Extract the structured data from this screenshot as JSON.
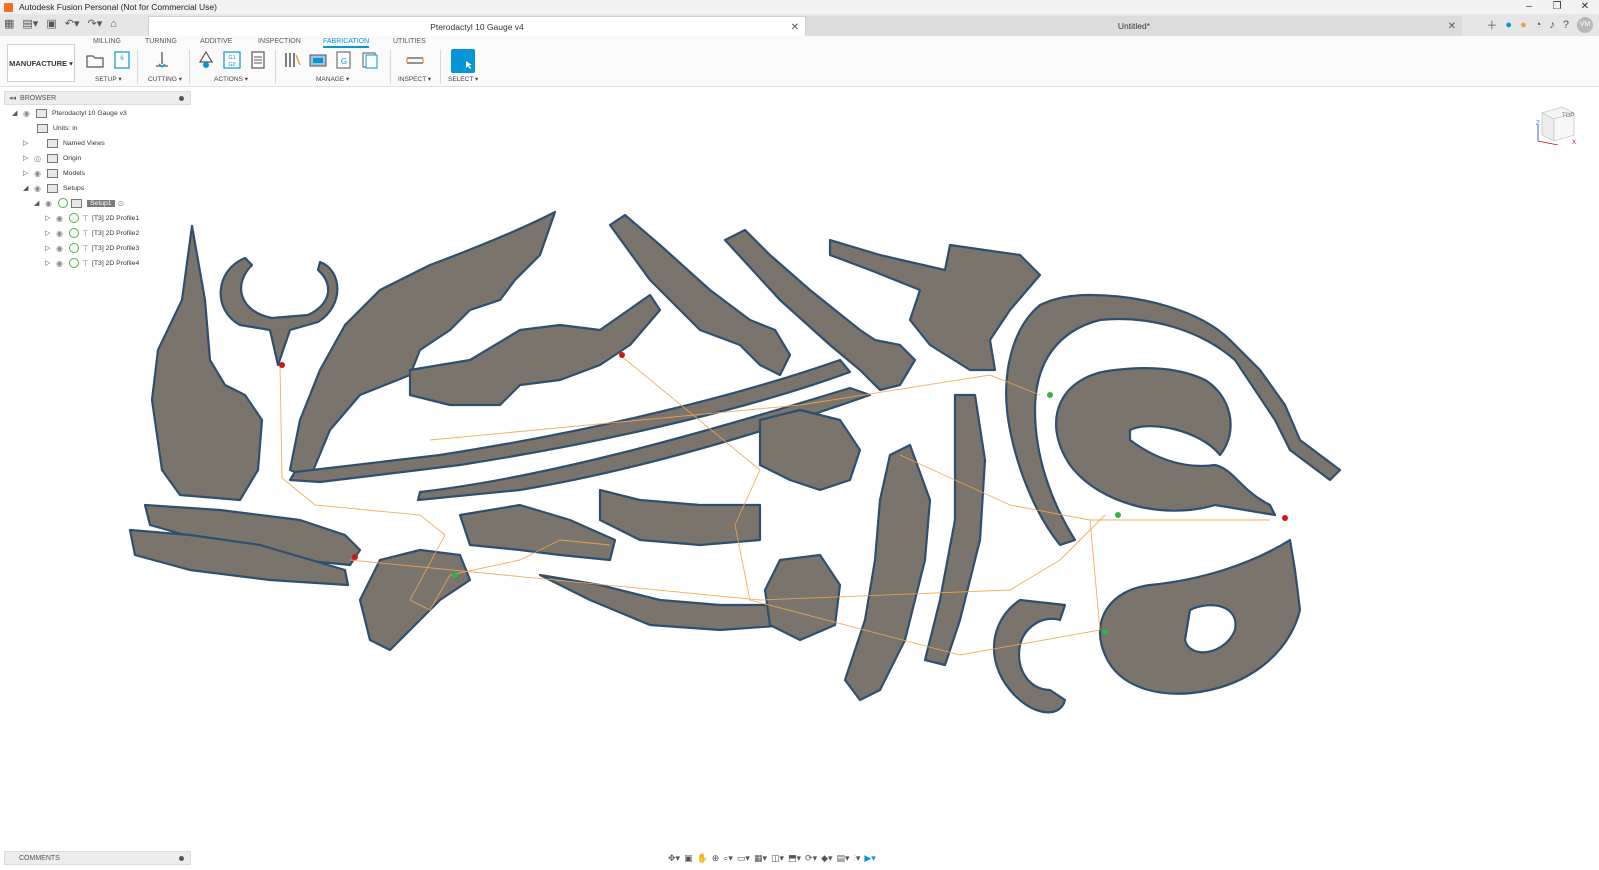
{
  "window": {
    "title": "Autodesk Fusion Personal (Not for Commercial Use)",
    "controls": [
      "–",
      "❐",
      "✕"
    ]
  },
  "document_tabs": [
    {
      "title": "Pterodactyl 10 Gauge v4",
      "active": true
    },
    {
      "title": "Untitled*",
      "active": false
    }
  ],
  "toolbar": {
    "workspace": "MANUFACTURE",
    "tabs": [
      "MILLING",
      "TURNING",
      "ADDITIVE",
      "INSPECTION",
      "FABRICATION",
      "UTILITIES"
    ],
    "active_tab": "FABRICATION",
    "groups": [
      "SETUP",
      "CUTTING",
      "ACTIONS",
      "MANAGE",
      "INSPECT",
      "SELECT"
    ],
    "actions_icon_text": [
      "G1",
      "G2"
    ],
    "accent": "#0696d7"
  },
  "browser": {
    "title": "BROWSER",
    "root": "Pterodactyl 10 Gauge v3",
    "units": "Units: in",
    "nodes": [
      "Named Views",
      "Origin",
      "Models",
      "Setups"
    ],
    "setup": "Setup1",
    "profiles": [
      "[T3] 2D Profile1",
      "[T3] 2D Profile2",
      "[T3] 2D Profile3",
      "[T3] 2D Profile4"
    ]
  },
  "viewcube": {
    "face": "TOP",
    "axis_x": "X",
    "axis_z": "Z"
  },
  "comments": {
    "title": "COMMENTS"
  },
  "user": {
    "initials": "VM"
  },
  "colors": {
    "part_fill": "#7b746c",
    "part_edge": "#2f4f6f",
    "toolpath": "#f2a550",
    "start_marker": "#d0141b",
    "end_marker": "#2fb34a"
  }
}
